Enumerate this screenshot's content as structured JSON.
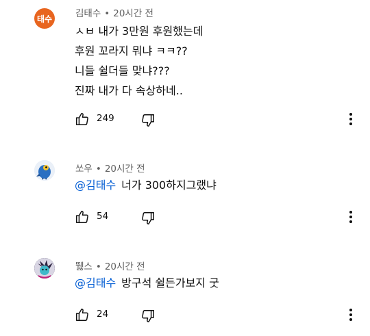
{
  "comments": [
    {
      "avatar_text": "태수",
      "author": "김태수",
      "time": "20시간 전",
      "mention": "",
      "lines": [
        "ㅅㅂ 내가 3만원 후원했는데",
        "후원 꼬라지 뭐냐 ㅋㅋ??",
        "니들 쉴더들 맞냐???",
        "진짜 내가 다 속상하네.."
      ],
      "likes": "249",
      "avatar_color": "#e8651f"
    },
    {
      "avatar_text": "",
      "author": "쏘우",
      "time": "20시간 전",
      "mention": "@김태수",
      "lines": [
        "너가 300하지그랬냐"
      ],
      "likes": "54",
      "avatar_color": "#2a6fc2"
    },
    {
      "avatar_text": "",
      "author": "뛣스",
      "time": "20시간 전",
      "mention": "@김태수",
      "lines": [
        "방구석 쉴든가보지 굿"
      ],
      "likes": "24",
      "avatar_color": "#3a3150"
    }
  ],
  "icons": {
    "like": "thumbs-up-icon",
    "dislike": "thumbs-down-icon",
    "more": "more-vertical-icon"
  }
}
